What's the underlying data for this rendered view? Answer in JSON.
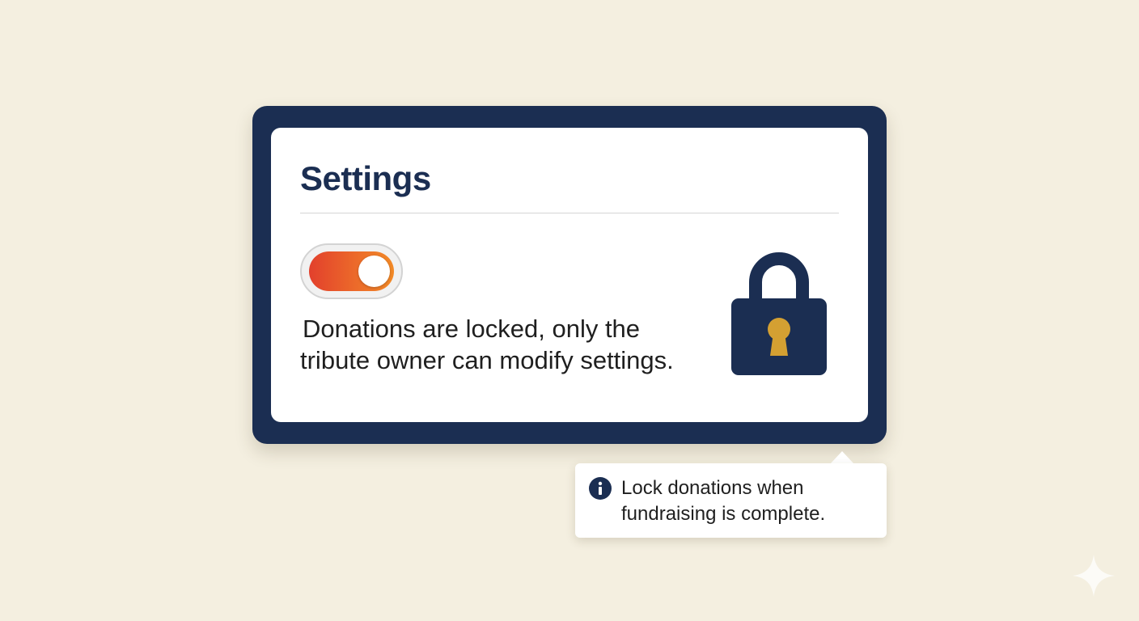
{
  "settings": {
    "title": "Settings",
    "donation_lock_toggle": {
      "state": "on",
      "accent_gradient": [
        "#e2402c",
        "#f28a27"
      ]
    },
    "status_message": {
      "line1": "Donations are locked, only the",
      "line2": "tribute owner can modify settings."
    },
    "lock_icon": "padlock-icon"
  },
  "tooltip": {
    "icon": "info-icon",
    "line1": "Lock donations when",
    "line2": "fundraising is complete."
  },
  "colors": {
    "background": "#f4efe0",
    "frame": "#1b2e52",
    "card": "#ffffff",
    "lock_body": "#1b2e52",
    "keyhole": "#d4a032",
    "text": "#1f1f1f"
  },
  "decorations": {
    "corner_mark": "sparkle-icon"
  }
}
